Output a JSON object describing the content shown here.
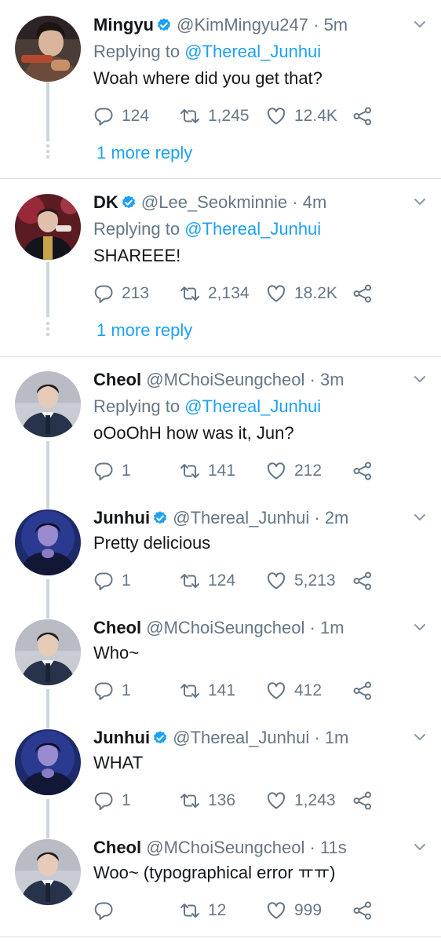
{
  "colors": {
    "link": "#1da1f2",
    "muted": "#657786",
    "text": "#14171a",
    "line": "#ccd6dd"
  },
  "tweets": [
    {
      "name": "Mingyu",
      "verified": true,
      "handle": "@KimMingyu247",
      "time": "5m",
      "reply_prefix": "Replying to ",
      "reply_to": "@Thereal_Junhui",
      "text": "Woah where did you get that?",
      "replies": "124",
      "retweets": "1,245",
      "likes": "12.4K",
      "more": "1 more reply",
      "avatar": "mingyu-avatar"
    },
    {
      "name": "DK",
      "verified": true,
      "handle": "@Lee_Seokminnie",
      "time": "4m",
      "reply_prefix": "Replying to ",
      "reply_to": "@Thereal_Junhui",
      "text": "SHAREEE!",
      "replies": "213",
      "retweets": "2,134",
      "likes": "18.2K",
      "more": "1 more reply",
      "avatar": "dk-avatar"
    },
    {
      "name": "Cheol",
      "verified": false,
      "handle": "@MChoiSeungcheol",
      "time": "3m",
      "reply_prefix": "Replying to ",
      "reply_to": "@Thereal_Junhui",
      "text": "oOoOhH how was it, Jun?",
      "replies": "1",
      "retweets": "141",
      "likes": "212",
      "avatar": "cheol-avatar"
    },
    {
      "name": "Junhui",
      "verified": true,
      "handle": "@Thereal_Junhui",
      "time": "2m",
      "text": "Pretty delicious",
      "replies": "1",
      "retweets": "124",
      "likes": "5,213",
      "avatar": "junhui-avatar"
    },
    {
      "name": "Cheol",
      "verified": false,
      "handle": "@MChoiSeungcheol",
      "time": "1m",
      "text": "Who~",
      "replies": "1",
      "retweets": "141",
      "likes": "412",
      "avatar": "cheol-avatar"
    },
    {
      "name": "Junhui",
      "verified": true,
      "handle": "@Thereal_Junhui",
      "time": "1m",
      "text": "WHAT",
      "replies": "1",
      "retweets": "136",
      "likes": "1,243",
      "avatar": "junhui-avatar"
    },
    {
      "name": "Cheol",
      "verified": false,
      "handle": "@MChoiSeungcheol",
      "time": "11s",
      "text": "Woo~ (typographical error ㅠㅠ)",
      "replies": "",
      "retweets": "12",
      "likes": "999",
      "avatar": "cheol-avatar"
    }
  ],
  "separator": "·"
}
